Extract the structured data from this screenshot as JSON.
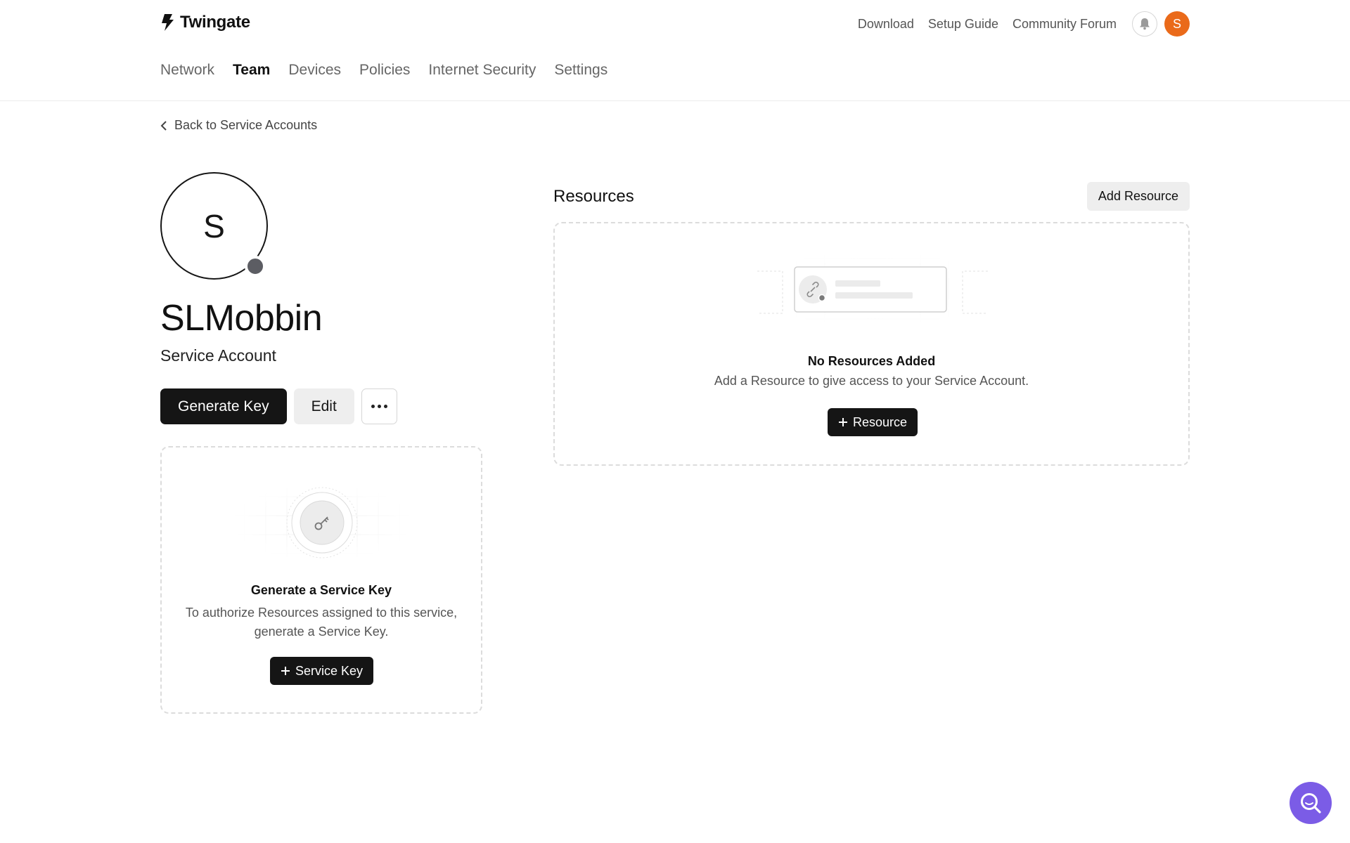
{
  "brand": {
    "name": "Twingate"
  },
  "top_links": [
    "Download",
    "Setup Guide",
    "Community Forum"
  ],
  "user": {
    "initial": "S",
    "color": "#ea6a1a"
  },
  "nav": {
    "items": [
      "Network",
      "Team",
      "Devices",
      "Policies",
      "Internet Security",
      "Settings"
    ],
    "active": "Team"
  },
  "back_link": "Back to Service Accounts",
  "account": {
    "initial": "S",
    "name": "SLMobbin",
    "type": "Service Account"
  },
  "actions": {
    "generate_key": "Generate Key",
    "edit": "Edit"
  },
  "key_card": {
    "title": "Generate a Service Key",
    "description": "To authorize Resources assigned to this service, generate a Service Key.",
    "button": "Service Key"
  },
  "resources": {
    "title": "Resources",
    "add_button": "Add Resource",
    "empty_title": "No Resources Added",
    "empty_description": "Add a Resource to give access to your Service Account.",
    "button": "Resource"
  },
  "colors": {
    "primary_dark": "#151515",
    "help_fab": "#7b5ce6",
    "status_dot": "#5c5d63"
  }
}
